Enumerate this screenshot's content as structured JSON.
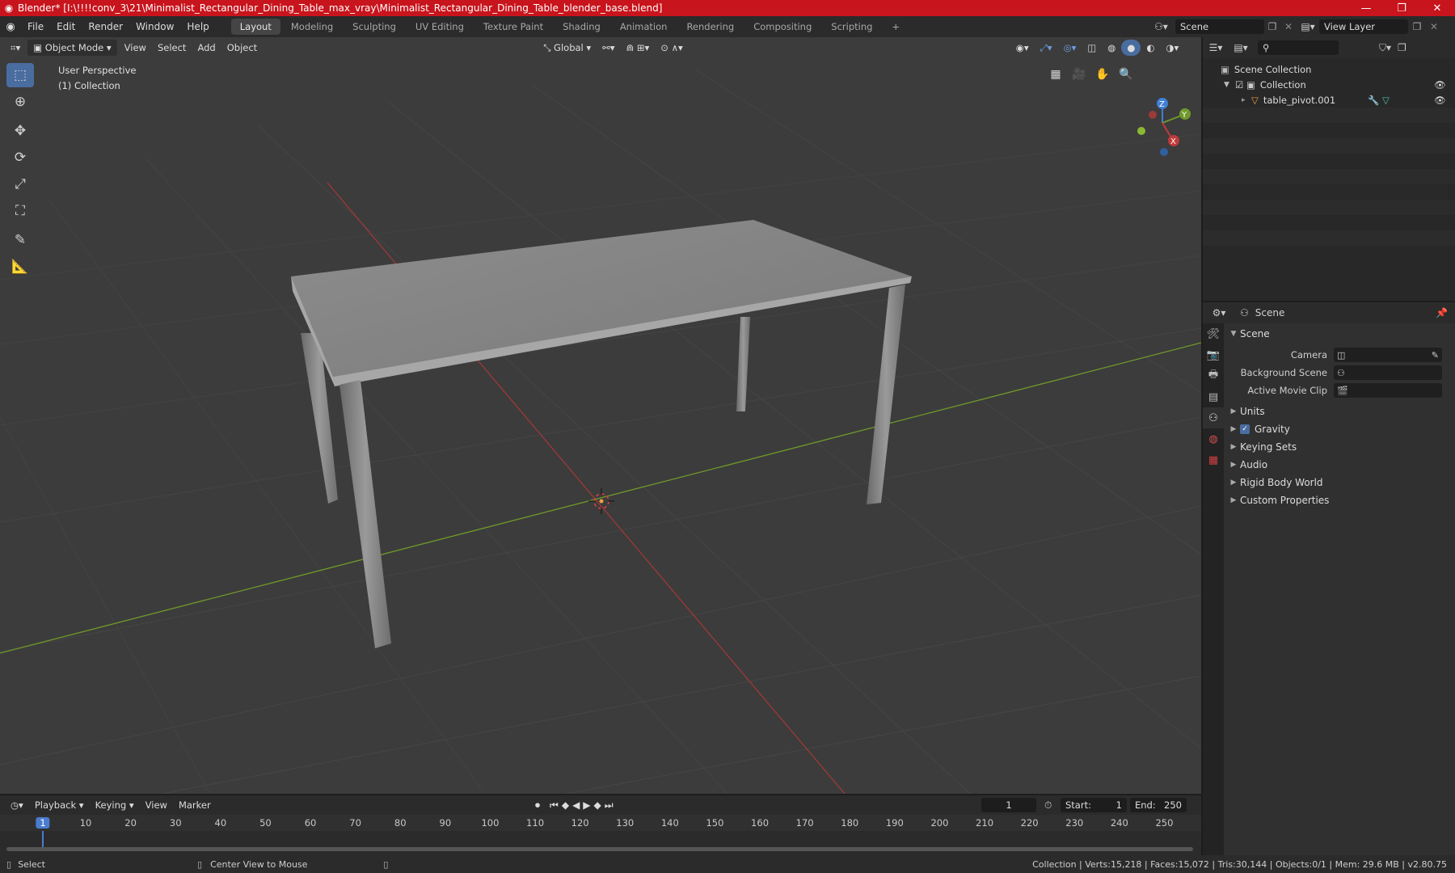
{
  "window": {
    "title": "Blender* [I:\\!!!!conv_3\\21\\Minimalist_Rectangular_Dining_Table_max_vray\\Minimalist_Rectangular_Dining_Table_blender_base.blend]",
    "minimize": "—",
    "maximize": "❐",
    "close": "✕"
  },
  "menu": [
    "File",
    "Edit",
    "Render",
    "Window",
    "Help"
  ],
  "workspaces": [
    "Layout",
    "Modeling",
    "Sculpting",
    "UV Editing",
    "Texture Paint",
    "Shading",
    "Animation",
    "Rendering",
    "Compositing",
    "Scripting"
  ],
  "active_workspace": "Layout",
  "add_workspace": "+",
  "scene_field": "Scene",
  "view_layer_field": "View Layer",
  "viewport": {
    "mode": "Object Mode",
    "menus": [
      "View",
      "Select",
      "Add",
      "Object"
    ],
    "orientation": "Global",
    "overlay_title": "User Perspective",
    "overlay_collection": "(1) Collection",
    "gizmo": {
      "x": "X",
      "y": "Y",
      "z": "Z"
    }
  },
  "outliner": {
    "root": "Scene Collection",
    "collection": "Collection",
    "object": "table_pivot.001"
  },
  "properties": {
    "header": "Scene",
    "panel": "Scene",
    "fields": [
      {
        "label": "Camera",
        "value": ""
      },
      {
        "label": "Background Scene",
        "value": ""
      },
      {
        "label": "Active Movie Clip",
        "value": ""
      }
    ],
    "subpanels": [
      "Units",
      "Gravity",
      "Keying Sets",
      "Audio",
      "Rigid Body World",
      "Custom Properties"
    ],
    "gravity_checked": true
  },
  "timeline": {
    "menus": [
      "Playback",
      "Keying",
      "View",
      "Marker"
    ],
    "current_frame": "1",
    "start_label": "Start:",
    "start": "1",
    "end_label": "End:",
    "end": "250",
    "ticks": [
      "1",
      "10",
      "20",
      "30",
      "40",
      "50",
      "60",
      "70",
      "80",
      "90",
      "100",
      "110",
      "120",
      "130",
      "140",
      "150",
      "160",
      "170",
      "180",
      "190",
      "200",
      "210",
      "220",
      "230",
      "240",
      "250"
    ]
  },
  "status": {
    "left": "Select",
    "middle": "Center View to Mouse",
    "right": "Collection | Verts:15,218 | Faces:15,072 | Tris:30,144 | Objects:0/1 | Mem: 29.6 MB | v2.80.75"
  },
  "colors": {
    "title_red": "#c8141c",
    "accent_blue": "#4a6da0",
    "axis_x": "#c03a3a",
    "axis_y": "#6f9a2a",
    "axis_z": "#3f7fd6"
  }
}
